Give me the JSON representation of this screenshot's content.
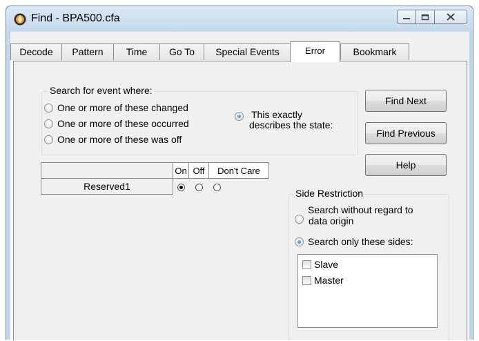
{
  "window": {
    "title": "Find - BPA500.cfa",
    "controls": [
      "minimize-icon",
      "maximize-icon",
      "close-icon"
    ]
  },
  "tabs": [
    {
      "label": "Decode",
      "active": false
    },
    {
      "label": "Pattern",
      "active": false
    },
    {
      "label": "Time",
      "active": false
    },
    {
      "label": "Go To",
      "active": false
    },
    {
      "label": "Special Events",
      "active": false
    },
    {
      "label": "Error",
      "active": true
    },
    {
      "label": "Bookmark",
      "active": false
    }
  ],
  "search_group": {
    "legend": "Search for event where:",
    "options": [
      {
        "label": "One or more of these changed",
        "checked": false
      },
      {
        "label": "One or more of these occurred",
        "checked": false
      },
      {
        "label": "One or more of these was off",
        "checked": false
      }
    ],
    "exact_option": {
      "label_line1": "This exactly",
      "label_line2": "describes the state:",
      "checked": true
    }
  },
  "buttons": {
    "find_next": "Find Next",
    "find_previous": "Find Previous",
    "help": "Help"
  },
  "state_table": {
    "headers": [
      "",
      "On",
      "Off",
      "Don't Care"
    ],
    "rows": [
      {
        "name": "Reserved1",
        "selected": "On"
      }
    ]
  },
  "side_restriction": {
    "legend": "Side Restriction",
    "option_any_line1": "Search without regard to",
    "option_any_line2": "data origin",
    "option_any_checked": false,
    "option_only": "Search only these sides:",
    "option_only_checked": true,
    "sides": [
      {
        "label": "Slave",
        "checked": false
      },
      {
        "label": "Master",
        "checked": false
      }
    ]
  }
}
